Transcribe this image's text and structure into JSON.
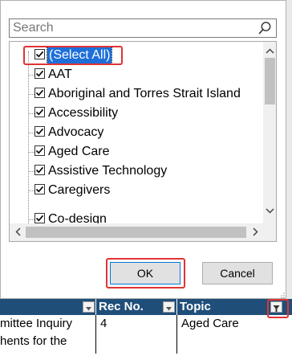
{
  "search": {
    "placeholder": "Search"
  },
  "filter_list": {
    "items": [
      {
        "label": "(Select All)",
        "checked": true
      },
      {
        "label": "AAT",
        "checked": true
      },
      {
        "label": "Aboriginal and Torres Strait Island",
        "checked": true
      },
      {
        "label": "Accessibility",
        "checked": true
      },
      {
        "label": "Advocacy",
        "checked": true
      },
      {
        "label": "Aged Care",
        "checked": true
      },
      {
        "label": "Assistive Technology",
        "checked": true
      },
      {
        "label": "Caregivers",
        "checked": true
      },
      {
        "label": "Co-design",
        "checked": true
      }
    ]
  },
  "buttons": {
    "ok": "OK",
    "cancel": "Cancel"
  },
  "sheet": {
    "headers": [
      "Rec No.",
      "Topic"
    ],
    "rows": [
      [
        "mittee Inquiry",
        "4",
        "Aged Care"
      ],
      [
        "hents for the",
        "",
        ""
      ]
    ]
  },
  "colors": {
    "highlight": "#e03434",
    "selection": "#1e6fd9",
    "header_bg": "#1f4e79"
  }
}
